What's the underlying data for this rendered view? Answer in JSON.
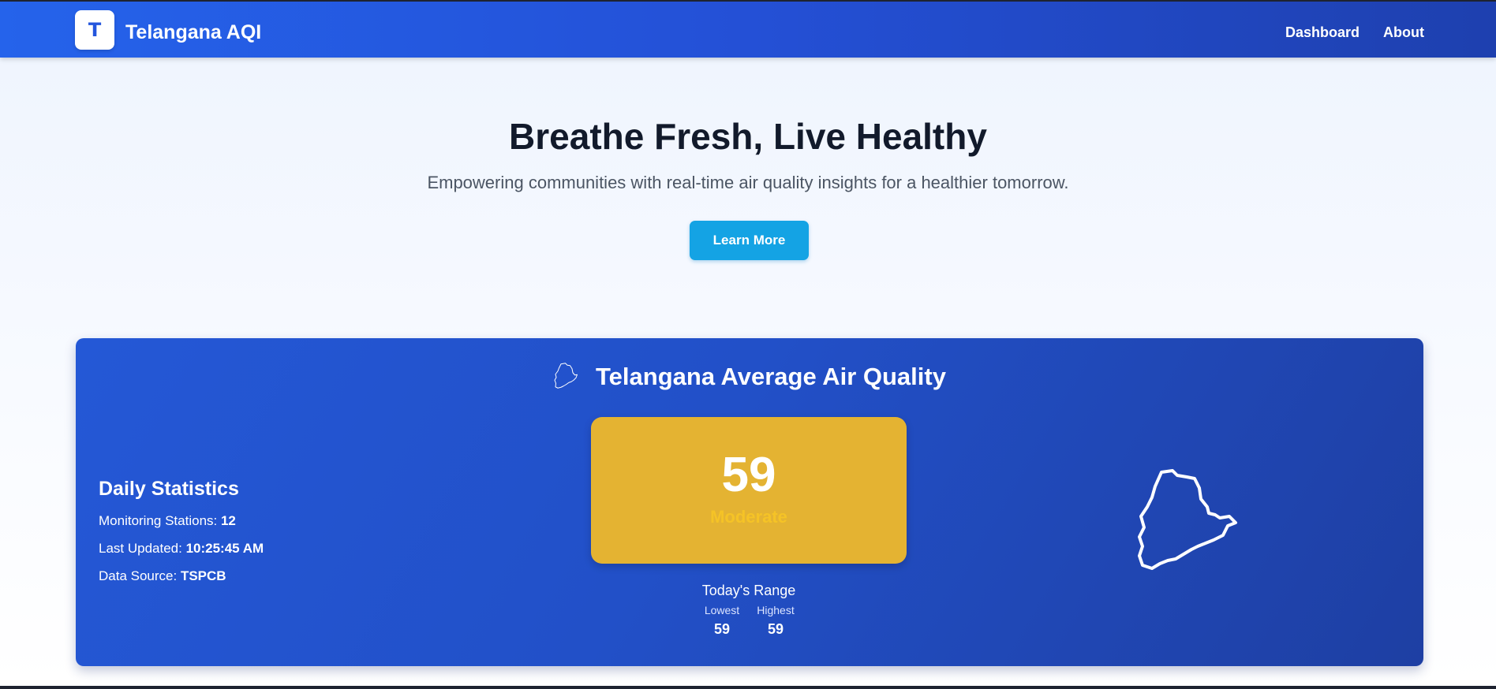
{
  "navbar": {
    "logo_letter": "T",
    "brand": "Telangana AQI",
    "links": [
      "Dashboard",
      "About"
    ]
  },
  "hero": {
    "title": "Breathe Fresh, Live Healthy",
    "subtitle": "Empowering communities with real-time air quality insights for a healthier tomorrow.",
    "button_label": "Learn More"
  },
  "aqi_card": {
    "title": "Telangana Average Air Quality",
    "title_icon": "telangana-map-icon",
    "stats": {
      "heading": "Daily Statistics",
      "stations_label": "Monitoring Stations: ",
      "stations_value": "12",
      "updated_label": "Last Updated: ",
      "updated_value": "10:25:45 AM",
      "source_label": "Data Source: ",
      "source_value": "TSPCB"
    },
    "aqi_value": "59",
    "aqi_category": "Moderate",
    "range": {
      "title": "Today's Range",
      "lowest_label": "Lowest",
      "lowest_value": "59",
      "highest_label": "Highest",
      "highest_value": "59"
    },
    "map_icon": "telangana-outline-icon"
  },
  "colors": {
    "nav_start": "#2563eb",
    "nav_end": "#1e40af",
    "button": "#14a3e4",
    "aqi_box": "#e4b332",
    "aqi_category": "#f5c326",
    "card_bg": "#2250c8"
  }
}
